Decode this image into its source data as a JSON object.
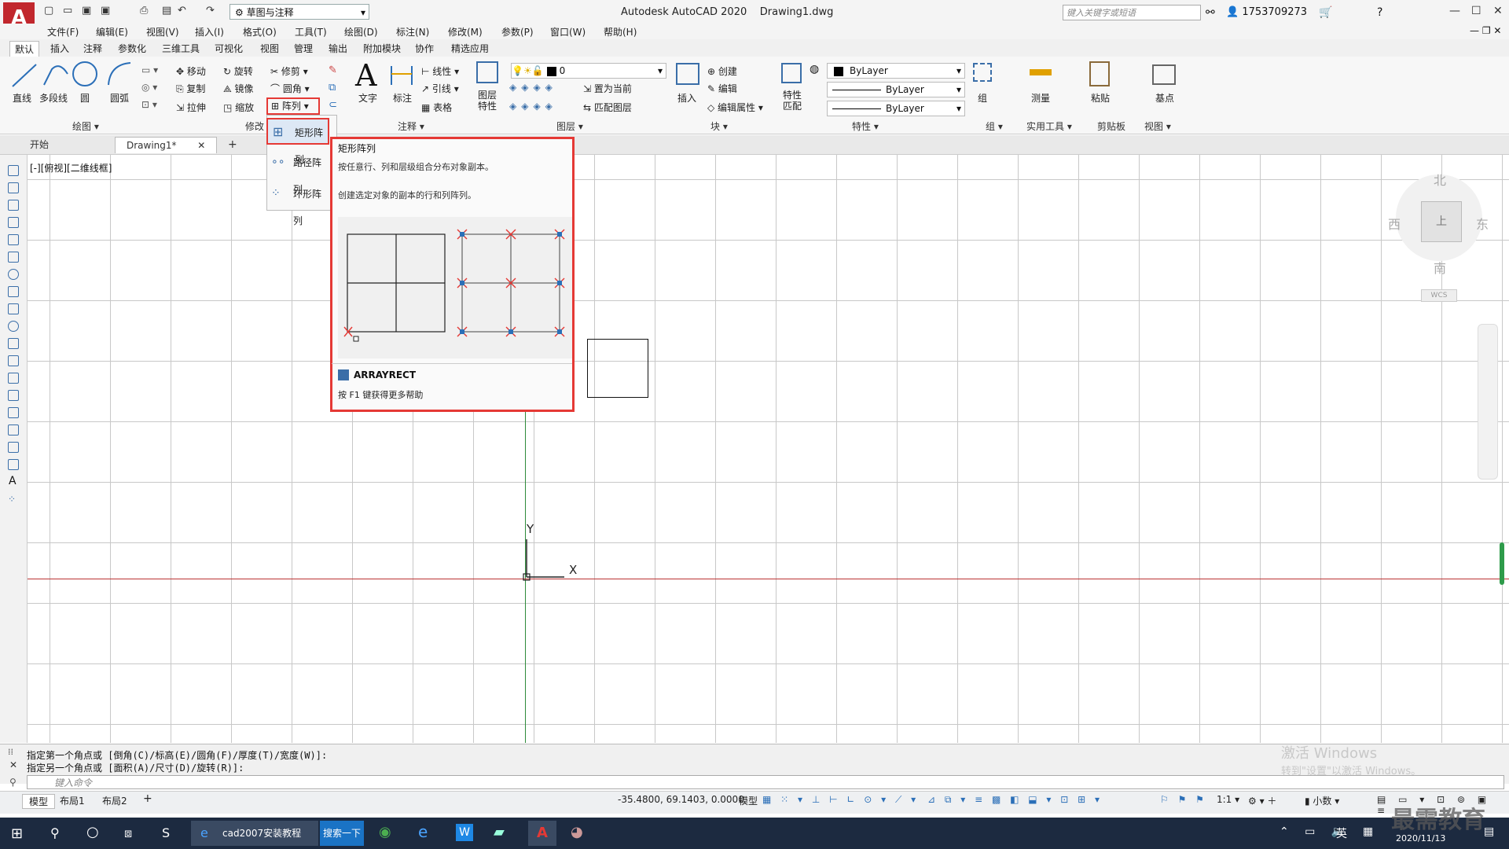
{
  "app": {
    "logo": "A",
    "workspace": "草图与注释",
    "title": "Autodesk AutoCAD 2020",
    "filename": "Drawing1.dwg",
    "search_placeholder": "键入关键字或短语",
    "user": "1753709273"
  },
  "menu": [
    "文件(F)",
    "编辑(E)",
    "视图(V)",
    "插入(I)",
    "格式(O)",
    "工具(T)",
    "绘图(D)",
    "标注(N)",
    "修改(M)",
    "参数(P)",
    "窗口(W)",
    "帮助(H)"
  ],
  "ribbon_tabs": [
    "默认",
    "插入",
    "注释",
    "参数化",
    "三维工具",
    "可视化",
    "视图",
    "管理",
    "输出",
    "附加模块",
    "协作",
    "精选应用"
  ],
  "ribbon": {
    "draw": {
      "label": "绘图",
      "line": "直线",
      "polyline": "多段线",
      "circle": "圆",
      "arc": "圆弧"
    },
    "modify": {
      "label": "修改",
      "move": "移动",
      "rotate": "旋转",
      "trim": "修剪",
      "copy": "复制",
      "mirror": "镜像",
      "fillet": "圆角",
      "stretch": "拉伸",
      "scale": "缩放",
      "array": "阵列"
    },
    "annotation": {
      "label": "注释",
      "text": "文字",
      "dimension": "标注",
      "linear": "线性",
      "leader": "引线",
      "table": "表格"
    },
    "layers": {
      "label": "图层",
      "props": "图层\n特性",
      "current_layer": "0",
      "set_current": "置为当前",
      "match_layer": "匹配图层"
    },
    "block": {
      "label": "块",
      "insert": "插入",
      "create": "创建",
      "edit": "编辑",
      "edit_attr": "编辑属性"
    },
    "properties": {
      "label": "特性",
      "match": "特性\n匹配",
      "color": "ByLayer",
      "linetype": "ByLayer",
      "lineweight": "ByLayer"
    },
    "groups": {
      "label": "组",
      "group": "组"
    },
    "utilities": {
      "label": "实用工具",
      "measure": "测量"
    },
    "clipboard": {
      "label": "剪贴板",
      "paste": "粘贴"
    },
    "view": {
      "label": "视图",
      "base": "基点"
    }
  },
  "doc_tabs": {
    "start": "开始",
    "drawing": "Drawing1*",
    "add": "+"
  },
  "viewport_label": "[-][俯视][二维线框]",
  "array_dropdown": [
    "矩形阵列",
    "路径阵列",
    "环形阵列"
  ],
  "tooltip": {
    "title": "矩形阵列",
    "desc1": "按任意行、列和层级组合分布对象副本。",
    "desc2": "创建选定对象的副本的行和列阵列。",
    "command": "ARRAYRECT",
    "help": "按 F1 键获得更多帮助"
  },
  "viewcube": {
    "north": "北",
    "south": "南",
    "east": "东",
    "west": "西",
    "top": "上",
    "wcs": "WCS"
  },
  "ucs": {
    "x": "X",
    "y": "Y"
  },
  "command": {
    "line1": "指定第一个角点或 [倒角(C)/标高(E)/圆角(F)/厚度(T)/宽度(W)]:",
    "line2": "指定另一个角点或 [面积(A)/尺寸(D)/旋转(R)]:",
    "placeholder": "键入命令"
  },
  "status": {
    "tabs": [
      "模型",
      "布局1",
      "布局2",
      "+"
    ],
    "coords": "-35.4800, 69.1403, 0.0000",
    "model": "模型",
    "scale": "1:1",
    "units": "小数"
  },
  "watermark": {
    "line1": "激活 Windows",
    "line2": "转到\"设置\"以激活 Windows。"
  },
  "taskbar": {
    "task": "cad2007安装教程",
    "search_btn": "搜索一下",
    "time": "2020/11/13",
    "ime": "英",
    "brand": "最需教育"
  }
}
